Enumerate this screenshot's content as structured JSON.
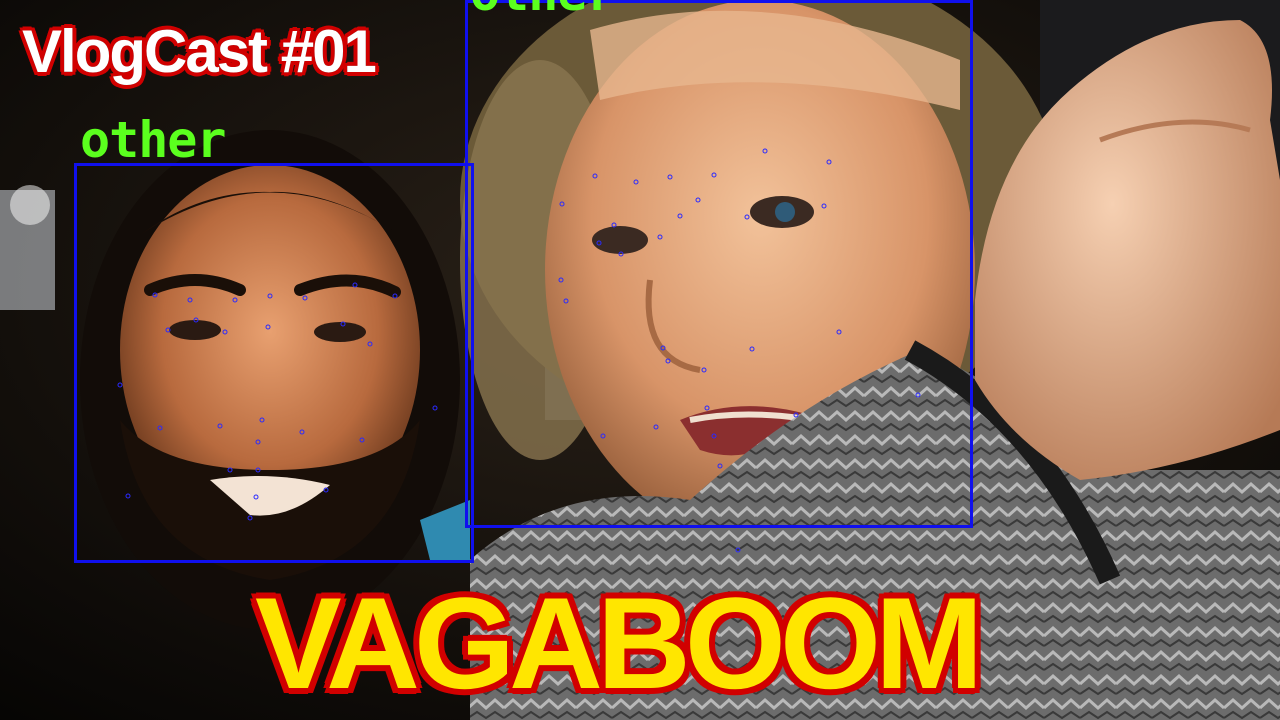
{
  "thumbnail": {
    "series_title": "VlogCast #01",
    "main_title": "VAGABOOM"
  },
  "detections": [
    {
      "label": "other"
    },
    {
      "label": "other"
    }
  ],
  "colors": {
    "bbox": "#1010ee",
    "label": "#5bff1e",
    "main_title_fill": "#ffe600",
    "title_outline": "#d10000"
  }
}
